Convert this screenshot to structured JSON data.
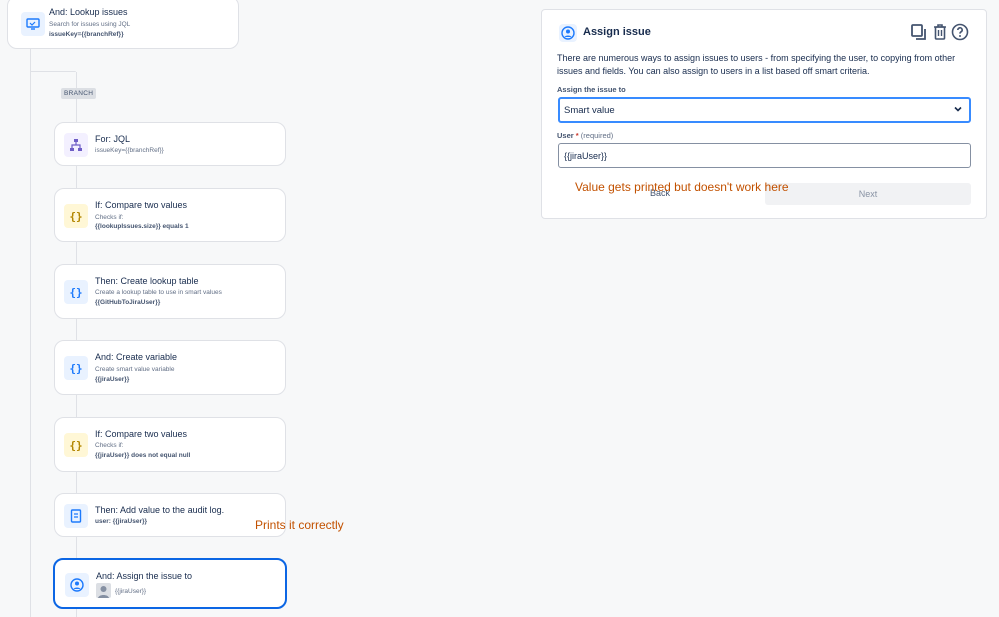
{
  "branch_label": "BRANCH",
  "cards": [
    {
      "title": "And: Lookup issues",
      "sub": "Search for issues using JQL",
      "bold": "issueKey={{branchRef}}",
      "icon": "lookup-icon"
    },
    {
      "title": "For: JQL",
      "sub": "issueKey={{branchRef}}",
      "icon": "branch-tree-icon"
    },
    {
      "title": "If: Compare two values",
      "sub": "Checks if:",
      "bold": "{{lookupIssues.size}} equals 1",
      "icon": "curly-braces-icon"
    },
    {
      "title": "Then: Create lookup table",
      "sub": "Create a lookup table to use in smart values",
      "bold": "{{GitHubToJiraUser}}",
      "icon": "curly-braces-icon"
    },
    {
      "title": "And: Create variable",
      "sub": "Create smart value variable",
      "bold": "{{jiraUser}}",
      "icon": "curly-braces-icon"
    },
    {
      "title": "If: Compare two values",
      "sub": "Checks if:",
      "bold": "{{jiraUser}} does not equal null",
      "icon": "curly-braces-icon"
    },
    {
      "title": "Then: Add value to the audit log.",
      "bold": "user: {{jiraUser}}",
      "icon": "audit-log-icon"
    },
    {
      "title": "And: Assign the issue to",
      "sub": "{{jiraUser}}",
      "icon": "assign-user-icon"
    }
  ],
  "annotations": {
    "left": "Prints it correctly",
    "right": "Value gets printed but doesn't work here"
  },
  "panel": {
    "title": "Assign issue",
    "description": "There are numerous ways to assign issues to users - from specifying the user, to copying from other issues and fields. You can also assign to users in a list based off smart criteria.",
    "assign_label": "Assign the issue to",
    "assign_value": "Smart value",
    "user_label": "User",
    "required_star": "*",
    "required_text": "(required)",
    "user_value": "{{jiraUser}}",
    "back_label": "Back",
    "next_label": "Next"
  },
  "colors": {
    "accent": "#0c66e4",
    "annotation": "#c25100"
  }
}
